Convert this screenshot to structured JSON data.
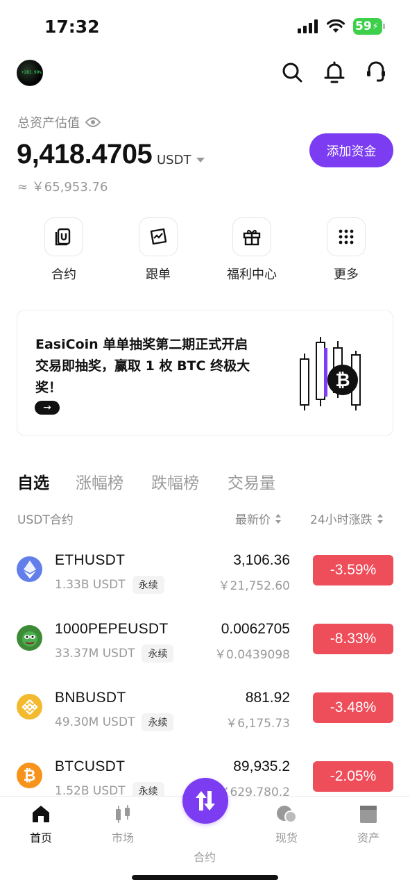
{
  "status_bar": {
    "time": "17:32",
    "battery": "59"
  },
  "header": {
    "avatar_text": "+281.99%"
  },
  "assets": {
    "label": "总资产估值",
    "value": "9,418.4705",
    "unit": "USDT",
    "cny": "≈ ￥65,953.76",
    "add_funds": "添加资金"
  },
  "quick_actions": [
    {
      "label": "合约",
      "icon": "contract-icon"
    },
    {
      "label": "跟单",
      "icon": "copy-trade-icon"
    },
    {
      "label": "福利中心",
      "icon": "gift-icon"
    },
    {
      "label": "更多",
      "icon": "grid-dots-icon"
    }
  ],
  "banner": {
    "text": "EasiCoin 单单抽奖第二期正式开启 交易即抽奖，赢取 1 枚 BTC 终极大奖！",
    "arrow": "→"
  },
  "market_tabs": [
    "自选",
    "涨幅榜",
    "跌幅榜",
    "交易量"
  ],
  "columns": {
    "pair": "USDT合约",
    "price": "最新价",
    "change": "24小时涨跌"
  },
  "rows": [
    {
      "symbol": "ETHUSDT",
      "volume": "1.33B USDT",
      "badge": "永续",
      "price": "3,106.36",
      "price_cny": "￥21,752.60",
      "change": "-3.59%",
      "icon": "eth-icon"
    },
    {
      "symbol": "1000PEPEUSDT",
      "volume": "33.37M USDT",
      "badge": "永续",
      "price": "0.0062705",
      "price_cny": "￥0.0439098",
      "change": "-8.33%",
      "icon": "pepe-icon"
    },
    {
      "symbol": "BNBUSDT",
      "volume": "49.30M USDT",
      "badge": "永续",
      "price": "881.92",
      "price_cny": "￥6,175.73",
      "change": "-3.48%",
      "icon": "bnb-icon"
    },
    {
      "symbol": "BTCUSDT",
      "volume": "1.52B USDT",
      "badge": "永续",
      "price": "89,935.2",
      "price_cny": "￥629,780.2",
      "change": "-2.05%",
      "icon": "btc-icon"
    }
  ],
  "bottom_nav": [
    {
      "label": "首页",
      "icon": "home-icon",
      "active": true
    },
    {
      "label": "市场",
      "icon": "candles-icon",
      "active": false
    },
    {
      "label": "合约",
      "icon": "swap-arrows-icon",
      "active": false
    },
    {
      "label": "现货",
      "icon": "spot-icon",
      "active": false
    },
    {
      "label": "资产",
      "icon": "wallet-icon",
      "active": false
    }
  ],
  "colors": {
    "accent": "#7b3cf2",
    "negative": "#ee4d5a"
  }
}
